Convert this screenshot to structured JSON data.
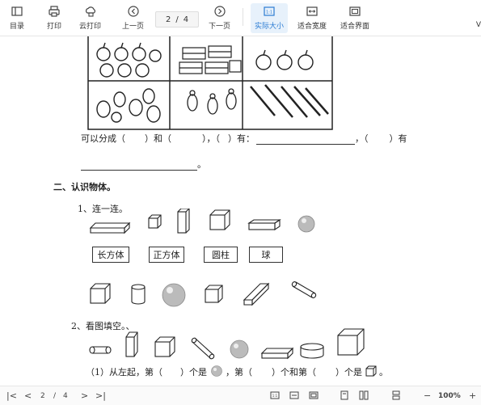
{
  "toolbar": {
    "buttons": [
      "目录",
      "打印",
      "云打印",
      "上一页",
      "下一页",
      "实际大小",
      "适合宽度",
      "适合界面"
    ],
    "page_current": "2",
    "page_sep": "/",
    "page_total": "4",
    "truncated": "V"
  },
  "doc": {
    "sentence1_a": "可以分成（",
    "sentence1_b": "）和（",
    "sentence1_c": "），（",
    "sentence1_d": "）有：",
    "sentence1_e": "，（",
    "sentence1_f": "）有",
    "end_mark": "。",
    "section2_title": "二、认识物体。",
    "q1": "1、连一连。",
    "labels": [
      "长方体",
      "正方体",
      "圆柱",
      "球"
    ],
    "q2": "2、看图填空。、",
    "q2_line_a": "（1）从左起，第（",
    "q2_line_b": "）个是",
    "q2_line_c": "，第（",
    "q2_line_d": "）个和第（",
    "q2_line_e": "）个是",
    "q2_line_f": "。"
  },
  "bottombar": {
    "page_current": "2",
    "page_sep": "/",
    "page_total": "4",
    "zoom": "100%"
  }
}
